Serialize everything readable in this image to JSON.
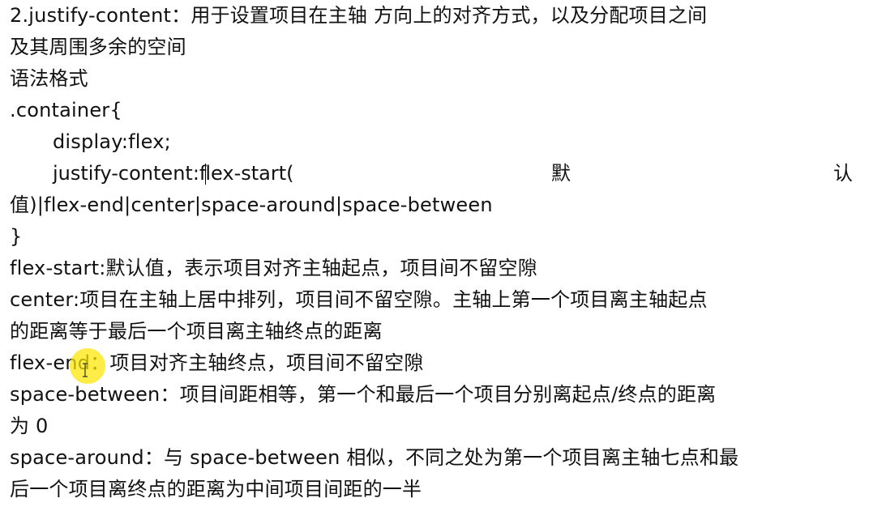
{
  "lines": [
    "2.justify-content：用于设置项目在主轴 方向上的对齐方式，以及分配项目之间",
    "及其周围多余的空间",
    "语法格式",
    ".container{",
    "display:flex;",
    "值)|flex-end|center|space-around|space-between",
    "}",
    "flex-start:默认值，表示项目对齐主轴起点，项目间不留空隙",
    "center:项目在主轴上居中排列，项目间不留空隙。主轴上第一个项目离主轴起点",
    "的距离等于最后一个项目离主轴终点的距离",
    "flex-end：项目对齐主轴终点，项目间不留空隙",
    "space-between：项目间距相等，第一个和最后一个项目分别离起点/终点的距离",
    "为 0",
    "space-around：与 space-between 相似，不同之处为第一个项目离主轴七点和最",
    "后一个项目离终点的距离为中间项目间距的一半"
  ],
  "justify_line": {
    "before_caret": "justify-content:f",
    "after_caret": "lex-start(",
    "mid": "默",
    "end": "认"
  }
}
